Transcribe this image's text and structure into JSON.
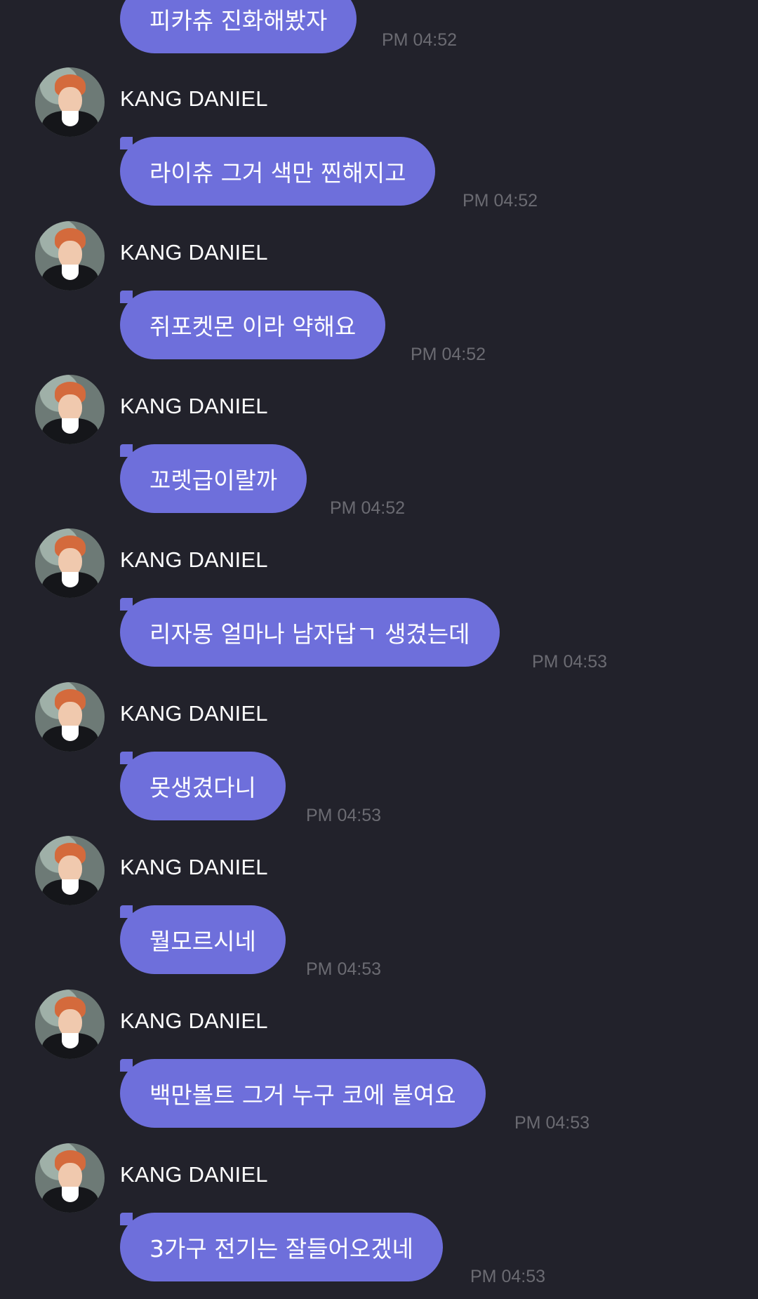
{
  "chat": {
    "top": {
      "text": "피카츄 진화해봤자",
      "time": "PM 04:52"
    },
    "messages": [
      {
        "sender": "KANG DANIEL",
        "text": "라이츄 그거 색만 찐해지고",
        "time": "PM 04:52"
      },
      {
        "sender": "KANG DANIEL",
        "text": "쥐포켓몬 이라 약해요",
        "time": "PM 04:52"
      },
      {
        "sender": "KANG DANIEL",
        "text": "꼬렛급이랄까",
        "time": "PM 04:52"
      },
      {
        "sender": "KANG DANIEL",
        "text": "리자몽 얼마나 남자답ㄱ 생겼는데",
        "time": "PM 04:53"
      },
      {
        "sender": "KANG DANIEL",
        "text": "못생겼다니",
        "time": "PM 04:53"
      },
      {
        "sender": "KANG DANIEL",
        "text": "뭘모르시네",
        "time": "PM 04:53"
      },
      {
        "sender": "KANG DANIEL",
        "text": "백만볼트 그거 누구 코에 붙여요",
        "time": "PM 04:53"
      },
      {
        "sender": "KANG DANIEL",
        "text": "3가구 전기는 잘들어오겠네",
        "time": "PM 04:53"
      }
    ]
  },
  "colors": {
    "background": "#22222b",
    "bubble": "#6e6fdb",
    "time_text": "#6b6b72"
  }
}
